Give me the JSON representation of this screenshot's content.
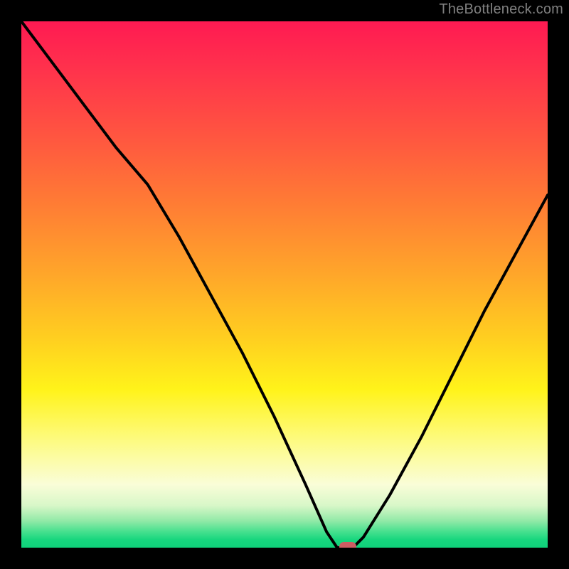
{
  "attribution": "TheBottleneck.com",
  "chart_data": {
    "type": "line",
    "title": "",
    "xlabel": "",
    "ylabel": "",
    "xlim": [
      0,
      100
    ],
    "ylim": [
      0,
      100
    ],
    "grid": false,
    "legend": false,
    "series": [
      {
        "name": "bottleneck-curve",
        "x": [
          0,
          6,
          12,
          18,
          24,
          30,
          36,
          42,
          48,
          54,
          58,
          60,
          63,
          65,
          70,
          76,
          82,
          88,
          94,
          100
        ],
        "y": [
          100,
          92,
          84,
          76,
          69,
          59,
          48,
          37,
          25,
          12,
          3,
          0,
          0,
          2,
          10,
          21,
          33,
          45,
          56,
          67
        ]
      }
    ],
    "marker": {
      "x": 62,
      "y": 0
    },
    "background_gradient": {
      "stops": [
        {
          "pos": 0,
          "color": "#ff1a52"
        },
        {
          "pos": 0.48,
          "color": "#ffa62a"
        },
        {
          "pos": 0.7,
          "color": "#fff31a"
        },
        {
          "pos": 0.88,
          "color": "#fafdd8"
        },
        {
          "pos": 1.0,
          "color": "#0fd17a"
        }
      ]
    }
  }
}
